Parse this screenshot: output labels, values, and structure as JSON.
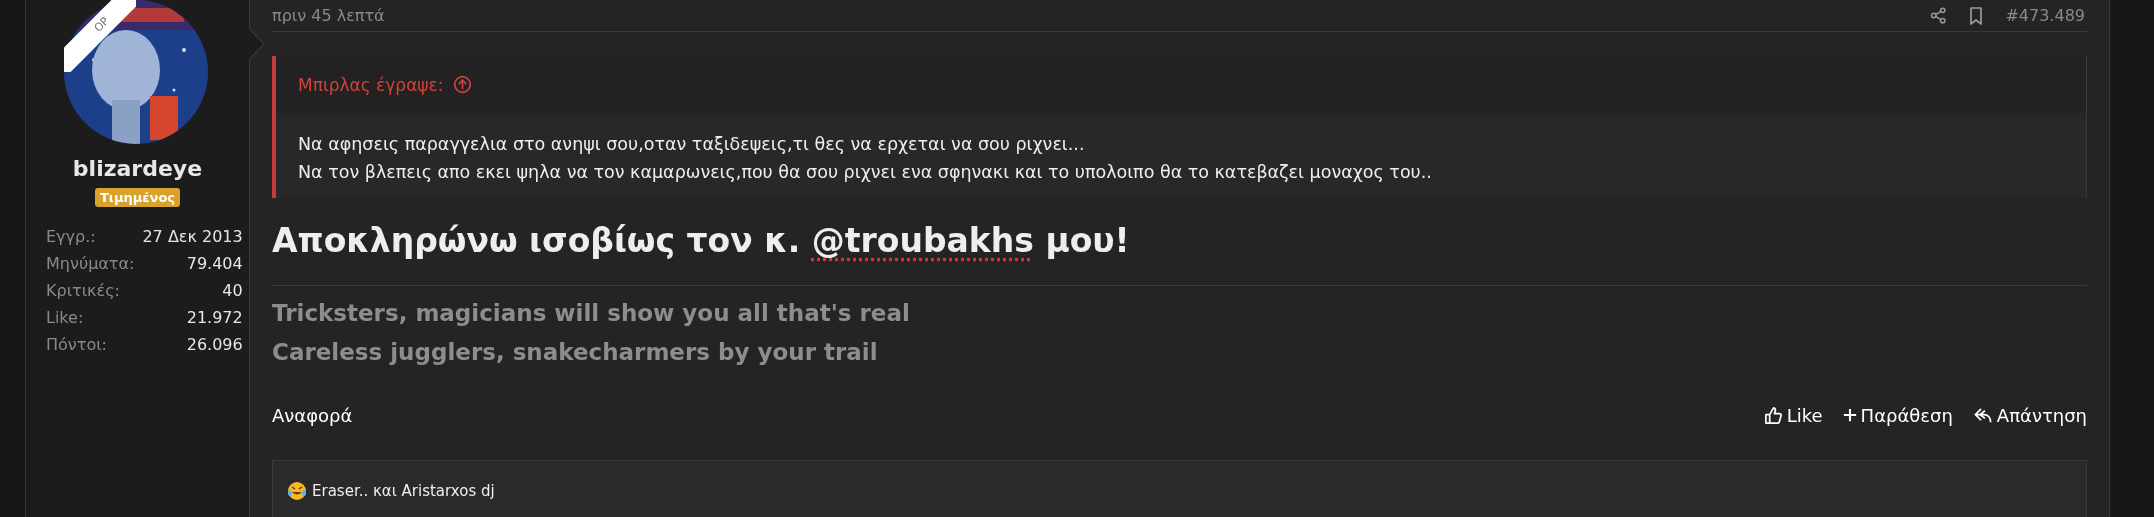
{
  "user": {
    "ribbon": "OP",
    "name": "blizardeye",
    "badge": "Τιμημένος",
    "stats": [
      {
        "label": "Εγγρ.:",
        "value": "27 Δεκ 2013"
      },
      {
        "label": "Μηνύματα:",
        "value": "79.404"
      },
      {
        "label": "Κριτικές:",
        "value": "40"
      },
      {
        "label": "Like:",
        "value": "21.972"
      },
      {
        "label": "Πόντοι:",
        "value": "26.096"
      }
    ]
  },
  "post": {
    "time": "πριν 45 λεπτά",
    "number": "#473.489",
    "quote": {
      "author": "Μπιρλας έγραψε:",
      "lines": [
        "Να αφησεις παραγγελια στο ανηψι σου,οταν ταξιδεψεις,τι θες να ερχεται να σου ριχνει...",
        "Να τον βλεπεις απο εκει ψηλα να τον καμαρωνεις,που θα σου ριχνει ενα σφηνακι και το υπολοιπο θα το κατεβαζει μοναχος του.."
      ]
    },
    "heading": {
      "before": "Αποκληρώνω ισοβίως τον κ. ",
      "mention": "@troubakhs",
      "after": " μου!"
    },
    "signature": [
      "Tricksters, magicians will show you all that's real",
      "Careless jugglers, snakecharmers by your trail"
    ],
    "report": "Αναφορά",
    "actions": [
      {
        "kind": "like",
        "label": "Like"
      },
      {
        "kind": "quote",
        "label": "Παράθεση"
      },
      {
        "kind": "reply",
        "label": "Απάντηση"
      }
    ],
    "reactions": "Eraser.. και Aristarxos dj"
  }
}
